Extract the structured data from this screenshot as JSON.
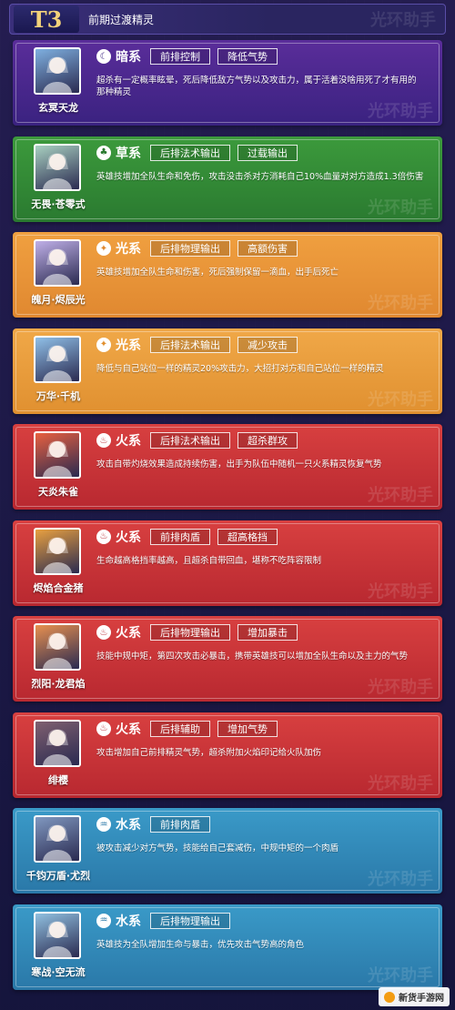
{
  "header": {
    "tier": "T3",
    "title": "前期过渡精灵",
    "watermark": "光环助手"
  },
  "watermark": "光环助手",
  "cards": [
    {
      "name": "玄冥天龙",
      "element": "暗系",
      "element_glyph": "☾",
      "tags": [
        "前排控制",
        "降低气势"
      ],
      "desc": "超杀有一定概率眩晕，死后降低敌方气势以及攻击力，属于活着没啥用死了才有用的那种精灵",
      "colors": [
        "#5a2d9a",
        "#3a2280"
      ],
      "portrait": "#7fb0e0"
    },
    {
      "name": "无畏·苍零式",
      "element": "草系",
      "element_glyph": "♣",
      "tags": [
        "后排法术输出",
        "过载输出"
      ],
      "desc": "英雄技增加全队生命和免伤，攻击没击杀对方消耗自己10%血量对对方造成1.3倍伤害",
      "colors": [
        "#3c9a3c",
        "#2a7a30"
      ],
      "portrait": "#a8d0c0"
    },
    {
      "name": "魄月·烬辰光",
      "element": "光系",
      "element_glyph": "✦",
      "tags": [
        "后排物理输出",
        "高额伤害"
      ],
      "desc": "英雄技增加全队生命和伤害，死后强制保留一滴血，出手后死亡",
      "colors": [
        "#f0a040",
        "#e08830"
      ],
      "portrait": "#c0b0e8"
    },
    {
      "name": "万华·千机",
      "element": "光系",
      "element_glyph": "✦",
      "tags": [
        "后排法术输出",
        "减少攻击"
      ],
      "desc": "降低与自己站位一样的精灵20%攻击力，大招打对方和自己站位一样的精灵",
      "colors": [
        "#f0a848",
        "#e09030"
      ],
      "portrait": "#90c0e8"
    },
    {
      "name": "天炎朱雀",
      "element": "火系",
      "element_glyph": "♨",
      "tags": [
        "后排法术输出",
        "超杀群攻"
      ],
      "desc": "攻击自带灼烧效果造成持续伤害，出手为队伍中随机一只火系精灵恢复气势",
      "colors": [
        "#d84040",
        "#b82830"
      ],
      "portrait": "#e86040"
    },
    {
      "name": "烬焰合金猪",
      "element": "火系",
      "element_glyph": "♨",
      "tags": [
        "前排肉盾",
        "超高格挡"
      ],
      "desc": "生命越高格挡率越高，且超杀自带回血，堪称不吃阵容限制",
      "colors": [
        "#d84040",
        "#b82830"
      ],
      "portrait": "#e8a040"
    },
    {
      "name": "烈阳·龙君焰",
      "element": "火系",
      "element_glyph": "♨",
      "tags": [
        "后排物理输出",
        "增加暴击"
      ],
      "desc": "技能中规中矩，第四次攻击必暴击，携带英雄技可以增加全队生命以及主力的气势",
      "colors": [
        "#d84040",
        "#b82830"
      ],
      "portrait": "#e89050"
    },
    {
      "name": "绯樱",
      "element": "火系",
      "element_glyph": "♨",
      "tags": [
        "后排辅助",
        "增加气势"
      ],
      "desc": "攻击增加自己前排精灵气势，超杀附加火焰印记给火队加伤",
      "colors": [
        "#d84040",
        "#b82830"
      ],
      "portrait": "#806070"
    },
    {
      "name": "千钧万盾·尤烈",
      "element": "水系",
      "element_glyph": "♒",
      "tags": [
        "前排肉盾"
      ],
      "desc": "被攻击减少对方气势，技能给自己套减伤，中规中矩的一个肉盾",
      "colors": [
        "#3a9ac8",
        "#2a78a8"
      ],
      "portrait": "#8098c0"
    },
    {
      "name": "寒战·空无流",
      "element": "水系",
      "element_glyph": "♒",
      "tags": [
        "后排物理输出"
      ],
      "desc": "英雄技为全队增加生命与暴击，优先攻击气势高的角色",
      "colors": [
        "#3a9ac8",
        "#2a78a8"
      ],
      "portrait": "#90c0e0"
    }
  ],
  "corner_logo": "新货手游网"
}
